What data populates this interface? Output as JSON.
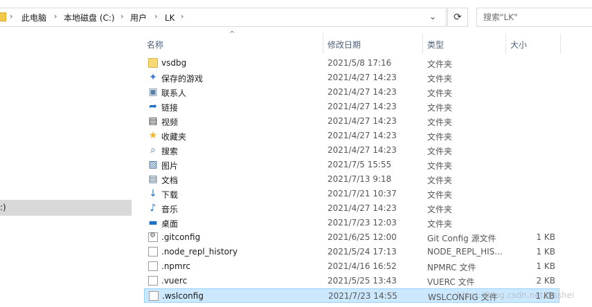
{
  "address": {
    "crumbs": [
      "此电脑",
      "本地磁盘 (C:)",
      "用户",
      "LK"
    ],
    "separator": "›",
    "dropdown_glyph": "⌄",
    "refresh_glyph": "⟳"
  },
  "search": {
    "placeholder": "搜索\"LK\""
  },
  "nav": {
    "selected_label": ":)"
  },
  "columns": {
    "name": "名称",
    "date": "修改日期",
    "type": "类型",
    "size": "大小",
    "sort_glyph": "^"
  },
  "rows": [
    {
      "icon": "folder-icon",
      "name": "vsdbg",
      "date": "2021/5/8 17:16",
      "type": "文件夹",
      "size": ""
    },
    {
      "icon": "saved-games-icon",
      "name": "保存的游戏",
      "date": "2021/4/27 14:23",
      "type": "文件夹",
      "size": ""
    },
    {
      "icon": "contacts-icon",
      "name": "联系人",
      "date": "2021/4/27 14:23",
      "type": "文件夹",
      "size": ""
    },
    {
      "icon": "links-icon",
      "name": "链接",
      "date": "2021/4/27 14:23",
      "type": "文件夹",
      "size": ""
    },
    {
      "icon": "videos-icon",
      "name": "视频",
      "date": "2021/4/27 14:23",
      "type": "文件夹",
      "size": ""
    },
    {
      "icon": "favorites-icon",
      "name": "收藏夹",
      "date": "2021/4/27 14:23",
      "type": "文件夹",
      "size": ""
    },
    {
      "icon": "searches-icon",
      "name": "搜索",
      "date": "2021/4/27 14:23",
      "type": "文件夹",
      "size": ""
    },
    {
      "icon": "pictures-icon",
      "name": "图片",
      "date": "2021/7/5 15:55",
      "type": "文件夹",
      "size": ""
    },
    {
      "icon": "documents-icon",
      "name": "文档",
      "date": "2021/7/13 9:18",
      "type": "文件夹",
      "size": ""
    },
    {
      "icon": "downloads-icon",
      "name": "下载",
      "date": "2021/7/21 10:37",
      "type": "文件夹",
      "size": ""
    },
    {
      "icon": "music-icon",
      "name": "音乐",
      "date": "2021/4/27 14:23",
      "type": "文件夹",
      "size": ""
    },
    {
      "icon": "desktop-icon",
      "name": "桌面",
      "date": "2021/7/23 12:03",
      "type": "文件夹",
      "size": ""
    },
    {
      "icon": "config-file-icon",
      "name": ".gitconfig",
      "date": "2021/6/25 12:00",
      "type": "Git Config 源文件",
      "size": "1 KB"
    },
    {
      "icon": "file-icon",
      "name": ".node_repl_history",
      "date": "2021/5/24 17:13",
      "type": "NODE_REPL_HIS...",
      "size": "1 KB"
    },
    {
      "icon": "file-icon",
      "name": ".npmrc",
      "date": "2021/4/16 16:52",
      "type": "NPMRC 文件",
      "size": "1 KB"
    },
    {
      "icon": "file-icon",
      "name": ".vuerc",
      "date": "2021/5/25 13:43",
      "type": "VUERC 文件",
      "size": "2 KB"
    },
    {
      "icon": "file-icon",
      "name": ".wslconfig",
      "date": "2021/7/23 14:55",
      "type": "WSLCONFIG 文件",
      "size": "1 KB"
    }
  ],
  "watermark": "https://blog.csdn.net/lksshei"
}
